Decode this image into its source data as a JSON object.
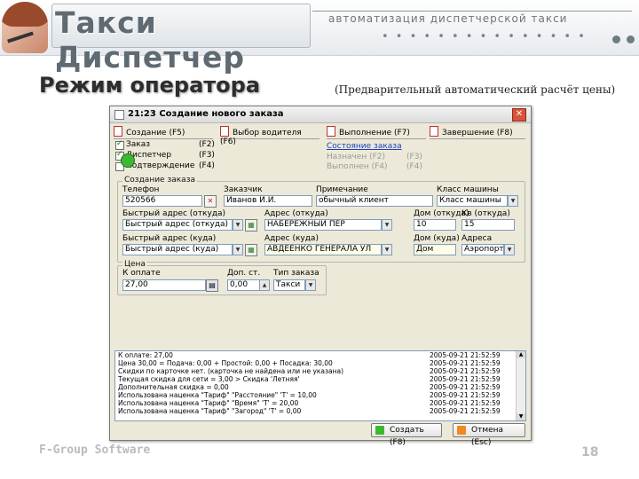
{
  "banner": {
    "brand": "Такси Диспетчер",
    "tagline": "автоматизация диспетчерской такси",
    "dots": "• • • • • • • • • • • • • • •"
  },
  "page": {
    "title": "Режим оператора",
    "subtitle": "(Предварительный автоматический расчёт цены)",
    "footer_left": "F-Group Software",
    "footer_number": "18"
  },
  "window": {
    "title": "21:23 Создание нового заказа",
    "close": "✕"
  },
  "steps": {
    "tabs": [
      {
        "label": "Создание (F5)"
      },
      {
        "label": "Выбор водителя (F6)"
      },
      {
        "label": "Выполнение (F7)"
      },
      {
        "label": "Завершение (F8)"
      }
    ],
    "creation_items": [
      {
        "label": "Заказ",
        "key": "(F2)",
        "checked": true
      },
      {
        "label": "Диспетчер",
        "key": "(F3)",
        "checked": true
      },
      {
        "label": "Подтверждение",
        "key": "(F4)",
        "checked": false
      }
    ],
    "driver_link": "Состояние заказа",
    "exec_rows": [
      {
        "label": "Назначен (F2)",
        "key": "(F3)"
      },
      {
        "label": "Выполнен (F4)",
        "key": "(F4)"
      }
    ]
  },
  "order": {
    "group_label": "Создание заказа",
    "phone_label": "Телефон",
    "phone_value": "520566",
    "client_label": "Заказчик",
    "client_value": "Иванов И.И.",
    "note_label": "Примечание",
    "note_value": "обычный клиент",
    "car_class_label": "Класс машины",
    "car_class_value": "Класс машины",
    "from_quick_label": "Быстрый адрес (откуда)",
    "from_quick_value": "Быстрый адрес (откуда)",
    "from_addr_label": "Адрес (откуда)",
    "from_addr_value": "НАБЕРЕЖНЫЙ ПЕР",
    "from_house_label": "Дом (откуда)",
    "from_house_value": "10",
    "from_apt_label": "Кв (откуда)",
    "from_apt_value": "15",
    "to_quick_label": "Быстрый адрес (куда)",
    "to_quick_value": "Быстрый адрес (куда)",
    "to_addr_label": "Адрес (куда)",
    "to_addr_value": "АВДЕЕНКО ГЕНЕРАЛА УЛ",
    "to_house_label": "Дом (куда)",
    "to_house_value": "Дом",
    "area_label": "Адреса",
    "area_value": "Аэропорт"
  },
  "price": {
    "group_label": "Цена",
    "price_label": "К оплате",
    "price_value": "27,00",
    "extra_label": "Доп. ст.",
    "extra_value": "0,00",
    "type_label": "Тип заказа",
    "type_value": "Такси"
  },
  "log": {
    "rows": [
      {
        "text": "К оплате: 27,00",
        "date": "2005-09-21 21:52:59"
      },
      {
        "text": "Цена 30,00 = Подача: 0,00 + Простой: 0,00 + Посадка: 30,00",
        "date": "2005-09-21 21:52:59"
      },
      {
        "text": "Скидки по карточке нет. (карточка не найдена или не указана)",
        "date": "2005-09-21 21:52:59"
      },
      {
        "text": "Текущая скидка для сети = 3,00 > Скидка 'Летняя'",
        "date": "2005-09-21 21:52:59"
      },
      {
        "text": "Дополнительная скидка = 0,00",
        "date": "2005-09-21 21:52:59"
      },
      {
        "text": "Использована наценка \"Тариф\" \"Расстояние\" 'Т' = 10,00",
        "date": "2005-09-21 21:52:59"
      },
      {
        "text": "Использована наценка \"Тариф\" \"Время\" 'Т' = 20,00",
        "date": "2005-09-21 21:52:59"
      },
      {
        "text": "Использована наценка \"Тариф\" \"Загород\" 'Т' = 0,00",
        "date": "2005-09-21 21:52:59"
      }
    ]
  },
  "buttons": {
    "create": "Создать (F8)",
    "cancel": "Отмена (Esc)"
  },
  "colors": {
    "window_bg": "#ece9d8",
    "link": "#1d3fbf",
    "close_red": "#d9533a",
    "create_icon": "#3db833",
    "cancel_icon": "#f08a1c"
  }
}
